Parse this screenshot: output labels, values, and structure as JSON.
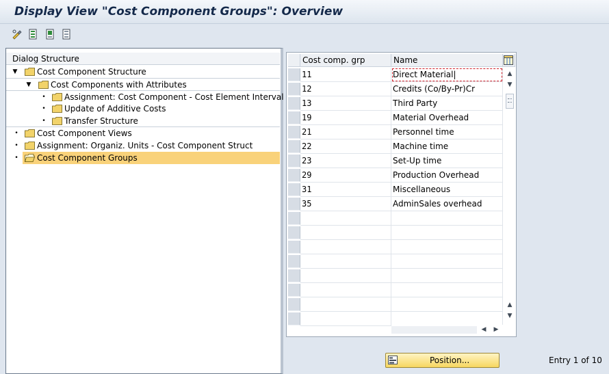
{
  "title": "Display View \"Cost Component Groups\": Overview",
  "toolbar": {
    "icons": [
      "edit-glasses-icon",
      "select-all-icon",
      "select-block-icon",
      "deselect-all-icon"
    ]
  },
  "dialog_structure": {
    "header": "Dialog Structure",
    "items": [
      {
        "label": "Cost Component Structure"
      },
      {
        "label": "Cost Components with Attributes"
      },
      {
        "label": "Assignment: Cost Component - Cost Element Interval"
      },
      {
        "label": "Update of Additive Costs"
      },
      {
        "label": "Transfer Structure"
      },
      {
        "label": "Cost Component Views"
      },
      {
        "label": "Assignment: Organiz. Units - Cost Component Struct"
      },
      {
        "label": "Cost Component Groups"
      }
    ]
  },
  "table": {
    "columns": [
      "Cost comp. grp",
      "Name"
    ],
    "rows": [
      {
        "code": "11",
        "name": "Direct Material"
      },
      {
        "code": "12",
        "name": "Credits (Co/By-Pr)Cr"
      },
      {
        "code": "13",
        "name": "Third Party"
      },
      {
        "code": "19",
        "name": "Material Overhead"
      },
      {
        "code": "21",
        "name": "Personnel time"
      },
      {
        "code": "22",
        "name": "Machine time"
      },
      {
        "code": "23",
        "name": "Set-Up time"
      },
      {
        "code": "29",
        "name": "Production Overhead"
      },
      {
        "code": "31",
        "name": "Miscellaneous"
      },
      {
        "code": "35",
        "name": "AdminSales overhead"
      }
    ]
  },
  "position_button": {
    "label": "Position..."
  },
  "entry_info": "Entry 1 of 10",
  "colors": {
    "selected": "#f9d27a",
    "folder": "#f2d36a",
    "button": "#f7d760"
  }
}
